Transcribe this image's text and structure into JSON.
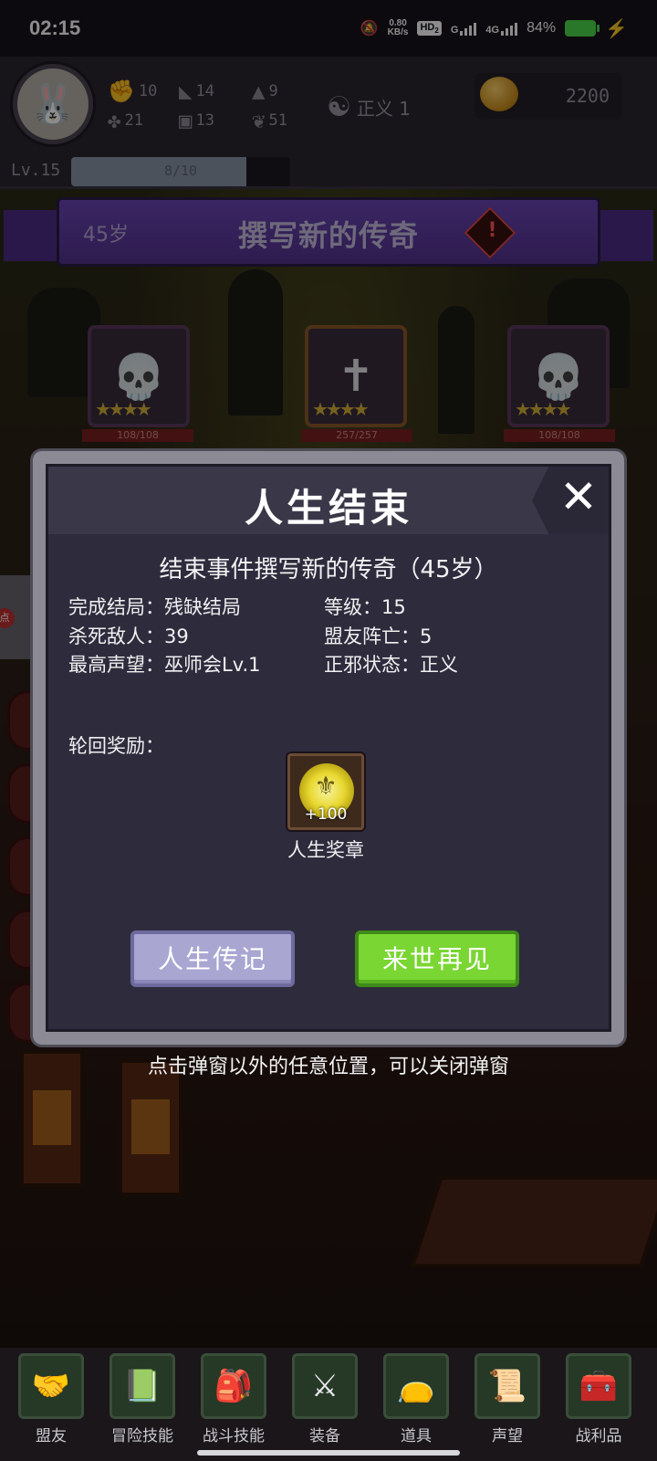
{
  "status_bar": {
    "time": "02:15",
    "net_speed_value": "0.80",
    "net_speed_unit": "KB/s",
    "hd_badge": "HD",
    "hd_sub": "2",
    "net_g": "G",
    "net_4g": "4G",
    "battery": "84%",
    "icons": [
      "dnd-off-icon",
      "signal-icon",
      "battery-icon",
      "charging-bolt-icon"
    ]
  },
  "player": {
    "avatar_icon": "bunny-avatar-icon",
    "stats": [
      {
        "icon": "fist-icon",
        "value": "10"
      },
      {
        "icon": "boot-icon",
        "value": "14"
      },
      {
        "icon": "wizard-hat-icon",
        "value": "9"
      },
      {
        "icon": "clover-icon",
        "value": "21"
      },
      {
        "icon": "armor-icon",
        "value": "13"
      },
      {
        "icon": "lotus-icon",
        "value": "51"
      }
    ],
    "alignment_label": "正义 1",
    "gold": "2200",
    "level": "Lv.15",
    "xp_text": "8/10",
    "xp_fraction": 0.8
  },
  "banner": {
    "age": "45岁",
    "title": "撰写新的传奇",
    "alert_icon": "!"
  },
  "enemies": [
    {
      "hp": "108/108",
      "stars": "★★★★"
    },
    {
      "hp": "257/257",
      "stars": "★★★★"
    },
    {
      "hp": "108/108",
      "stars": "★★★★"
    }
  ],
  "side_tab": {
    "badge": "点"
  },
  "dialog": {
    "title": "人生结束",
    "close_icon": "✕",
    "subtitle": "结束事件撰写新的传奇（45岁）",
    "info": {
      "ending": "完成结局：残缺结局",
      "level": "等级：15",
      "kills": "杀死敌人：39",
      "ally_deaths": "盟友阵亡：5",
      "reputation": "最高声望：巫师会Lv.1",
      "morality": "正邪状态：正义"
    },
    "reward_label": "轮回奖励：",
    "reward": {
      "qty": "+100",
      "name": "人生奖章",
      "icon": "medal-icon"
    },
    "btn_left": "人生传记",
    "btn_right": "来世再见"
  },
  "hint": "点击弹窗以外的任意位置，可以关闭弹窗",
  "bottom_nav": [
    {
      "label": "盟友",
      "icon": "handshake-icon"
    },
    {
      "label": "冒险技能",
      "icon": "book-icon"
    },
    {
      "label": "战斗技能",
      "icon": "backpack-icon"
    },
    {
      "label": "装备",
      "icon": "shield-swords-icon"
    },
    {
      "label": "道具",
      "icon": "pouch-icon"
    },
    {
      "label": "声望",
      "icon": "scroll-icon"
    },
    {
      "label": "战利品",
      "icon": "treasure-chest-icon"
    }
  ]
}
